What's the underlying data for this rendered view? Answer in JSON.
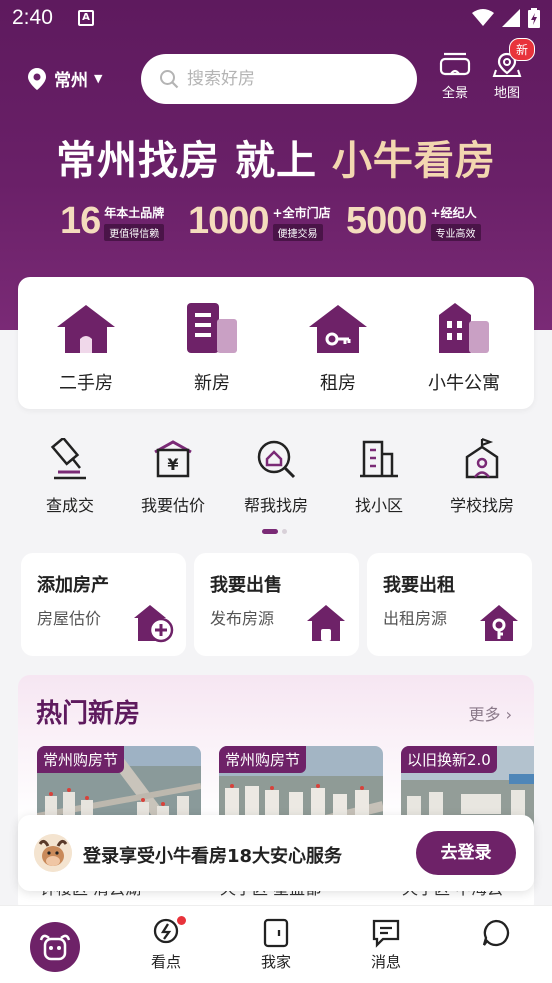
{
  "status": {
    "time": "2:40"
  },
  "header": {
    "city": "常州",
    "search_placeholder": "搜索好房",
    "panorama_label": "全景",
    "map_label": "地图",
    "map_badge": "新"
  },
  "banner": {
    "slogan_left": "常州找房 就上",
    "slogan_right": "小牛看房",
    "stats": [
      {
        "num": "16",
        "label": "年本土品牌",
        "tag": "更值得信赖"
      },
      {
        "num": "1000",
        "label": "+全市门店",
        "tag": "便捷交易"
      },
      {
        "num": "5000",
        "label": "+经纪人",
        "tag": "专业高效"
      }
    ]
  },
  "categories": [
    {
      "label": "二手房",
      "icon": "house-door-icon"
    },
    {
      "label": "新房",
      "icon": "building-icon"
    },
    {
      "label": "租房",
      "icon": "house-key-icon"
    },
    {
      "label": "小牛公寓",
      "icon": "apartment-icon"
    }
  ],
  "tools": [
    {
      "label": "查成交",
      "icon": "gavel-icon"
    },
    {
      "label": "我要估价",
      "icon": "price-house-icon"
    },
    {
      "label": "帮我找房",
      "icon": "search-house-icon"
    },
    {
      "label": "找小区",
      "icon": "community-icon"
    },
    {
      "label": "学校找房",
      "icon": "school-icon"
    }
  ],
  "actions": [
    {
      "title": "添加房产",
      "sub": "房屋估价",
      "icon": "house-plus-icon"
    },
    {
      "title": "我要出售",
      "sub": "发布房源",
      "icon": "house-sell-icon"
    },
    {
      "title": "我要出租",
      "sub": "出租房源",
      "icon": "house-key-icon"
    }
  ],
  "hot": {
    "title": "热门新房",
    "more": "更多",
    "cards": [
      {
        "tag": "常州购房节",
        "peek": "钟楼区·清云湖"
      },
      {
        "tag": "常州购房节",
        "peek": "天宁区·星盛都"
      },
      {
        "tag": "以旧换新2.0",
        "peek": "天宁区·中海云"
      }
    ]
  },
  "login": {
    "message": "登录享受小牛看房18大安心服务",
    "button": "去登录"
  },
  "nav": {
    "items": [
      "看点",
      "我家",
      "消息"
    ]
  },
  "colors": {
    "brand": "#6e2268",
    "gold": "#f3d7b0",
    "badge": "#e8333b"
  }
}
